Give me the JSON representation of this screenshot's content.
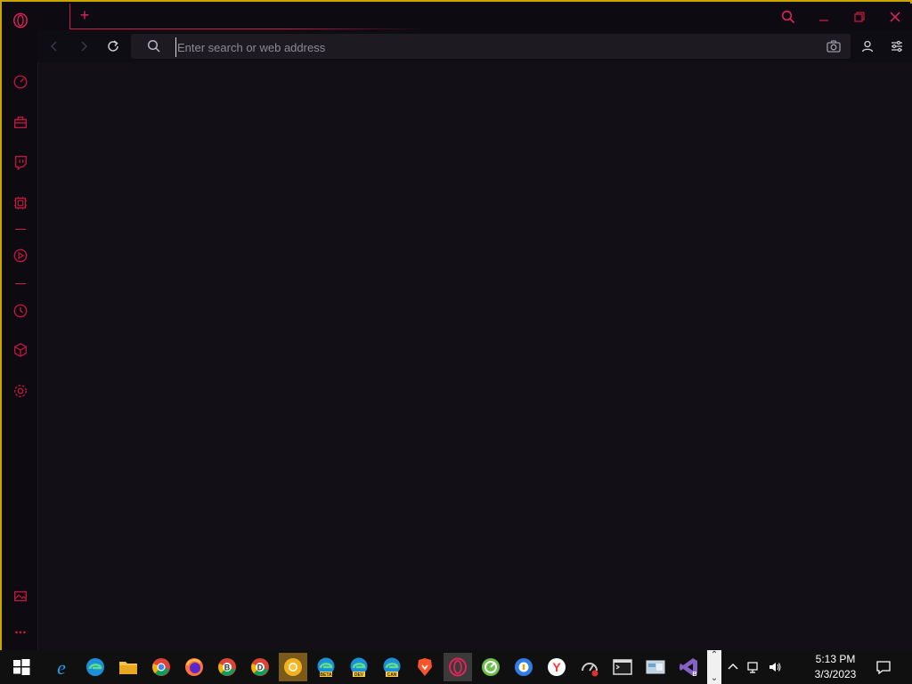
{
  "address_bar": {
    "placeholder": "Enter search or web address",
    "value": ""
  },
  "tabstrip": {
    "new_tab_label": "+"
  },
  "sidebar": {
    "items": [
      {
        "name": "opera-logo-icon"
      },
      {
        "name": "speed-dial-icon"
      },
      {
        "name": "gx-corner-icon"
      },
      {
        "name": "twitch-icon"
      },
      {
        "name": "gx-control-icon"
      },
      {
        "name": "player-icon"
      },
      {
        "name": "history-icon"
      },
      {
        "name": "extensions-icon"
      },
      {
        "name": "settings-icon"
      },
      {
        "name": "wallpaper-icon"
      },
      {
        "name": "more-icon"
      }
    ]
  },
  "taskbar": {
    "clock_time": "5:13 PM",
    "clock_date": "3/3/2023",
    "apps": [
      {
        "name": "start-icon"
      },
      {
        "name": "internet-explorer-icon"
      },
      {
        "name": "edge-icon"
      },
      {
        "name": "file-explorer-icon"
      },
      {
        "name": "chrome-icon"
      },
      {
        "name": "firefox-icon"
      },
      {
        "name": "chrome-beta-icon",
        "letter": "B"
      },
      {
        "name": "chrome-dev-icon",
        "letter": "D"
      },
      {
        "name": "chrome-canary-icon"
      },
      {
        "name": "edge-beta-icon",
        "tag": "BETA"
      },
      {
        "name": "edge-dev-icon",
        "tag": "DEV"
      },
      {
        "name": "edge-canary-icon",
        "tag": "CAN"
      },
      {
        "name": "brave-icon"
      },
      {
        "name": "opera-gx-icon"
      },
      {
        "name": "green-app-icon"
      },
      {
        "name": "blue-app-icon"
      },
      {
        "name": "yandex-icon",
        "letter": "Y"
      },
      {
        "name": "speed-test-icon"
      },
      {
        "name": "terminal-icon"
      },
      {
        "name": "control-panel-icon"
      },
      {
        "name": "visual-studio-icon",
        "letter": "B"
      }
    ]
  },
  "colors": {
    "accent": "#e0245b",
    "frame_border": "#c9a400",
    "background": "#120f17"
  }
}
